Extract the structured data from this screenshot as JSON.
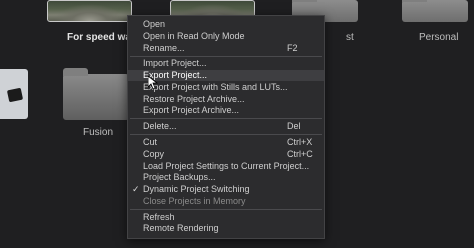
{
  "projects": [
    {
      "name": "For speed warp"
    },
    {
      "name": "st"
    },
    {
      "name": "Personal"
    },
    {
      "name": "Fusion"
    }
  ],
  "context_menu": {
    "items": [
      {
        "label": "Open",
        "shortcut": "",
        "enabled": true
      },
      {
        "label": "Open in Read Only Mode",
        "shortcut": "",
        "enabled": true
      },
      {
        "label": "Rename...",
        "shortcut": "F2",
        "enabled": true
      },
      {
        "label": "Import Project...",
        "shortcut": "",
        "enabled": true
      },
      {
        "label": "Export Project...",
        "shortcut": "",
        "enabled": true,
        "highlighted": true
      },
      {
        "label": "Export Project with Stills and LUTs...",
        "shortcut": "",
        "enabled": true
      },
      {
        "label": "Restore Project Archive...",
        "shortcut": "",
        "enabled": true
      },
      {
        "label": "Export Project Archive...",
        "shortcut": "",
        "enabled": true
      },
      {
        "label": "Delete...",
        "shortcut": "Del",
        "enabled": true
      },
      {
        "label": "Cut",
        "shortcut": "Ctrl+X",
        "enabled": true
      },
      {
        "label": "Copy",
        "shortcut": "Ctrl+C",
        "enabled": true
      },
      {
        "label": "Load Project Settings to Current Project...",
        "shortcut": "",
        "enabled": true
      },
      {
        "label": "Project Backups...",
        "shortcut": "",
        "enabled": true
      },
      {
        "label": "Dynamic Project Switching",
        "shortcut": "",
        "enabled": true,
        "checked": true
      },
      {
        "label": "Close Projects in Memory",
        "shortcut": "",
        "enabled": false
      },
      {
        "label": "Refresh",
        "shortcut": "",
        "enabled": true
      },
      {
        "label": "Remote Rendering",
        "shortcut": "",
        "enabled": true
      }
    ]
  },
  "colors": {
    "background": "#1f1f21",
    "menu_background": "#2c2c2e",
    "menu_highlight": "#3e3e41",
    "menu_text": "#cfcfcf",
    "disabled_text": "#8a8a8a"
  }
}
